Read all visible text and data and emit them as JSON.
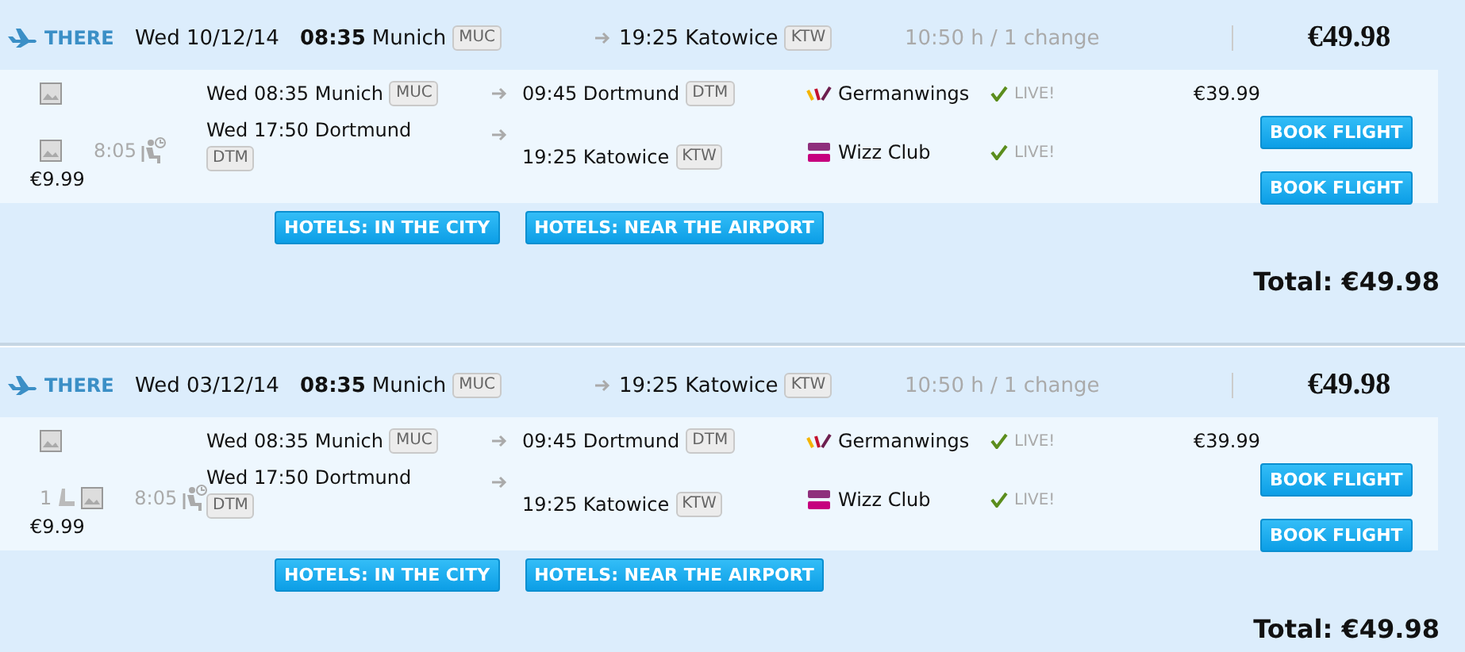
{
  "results": [
    {
      "direction": "THERE",
      "date": "Wed 10/12/14",
      "dep_time": "08:35",
      "dep_city": "Munich",
      "dep_code": "MUC",
      "arrival": "19:25 Katowice",
      "arr_code": "KTW",
      "duration": "10:50 h / 1 change",
      "price": "€49.98",
      "segments": [
        {
          "departure": "Wed 08:35 Munich",
          "from_code": "MUC",
          "arrival": "09:45 Dortmund",
          "to_code": "DTM",
          "airline": "Germanwings",
          "kind": "germanwings",
          "status": "LIVE!",
          "price": "€39.99"
        },
        {
          "departure": "Wed 17:50 Dortmund",
          "from_code": "DTM",
          "arrival": "19:25 Katowice",
          "to_code": "KTW",
          "airline": "Wizz Club",
          "kind": "wizz",
          "status": "LIVE!",
          "price": "€9.99",
          "layover": "8:05"
        }
      ],
      "book_buttons": [
        "BOOK FLIGHT",
        "BOOK FLIGHT"
      ],
      "hotel_buttons": [
        "HOTELS: IN THE CITY",
        "HOTELS: NEAR THE AIRPORT"
      ],
      "total": "Total: €49.98"
    },
    {
      "direction": "THERE",
      "date": "Wed 03/12/14",
      "dep_time": "08:35",
      "dep_city": "Munich",
      "dep_code": "MUC",
      "arrival": "19:25 Katowice",
      "arr_code": "KTW",
      "duration": "10:50 h / 1 change",
      "price": "€49.98",
      "segments": [
        {
          "departure": "Wed 08:35 Munich",
          "from_code": "MUC",
          "arrival": "09:45 Dortmund",
          "to_code": "DTM",
          "airline": "Germanwings",
          "kind": "germanwings",
          "status": "LIVE!",
          "price": "€39.99"
        },
        {
          "departure": "Wed 17:50 Dortmund",
          "from_code": "DTM",
          "arrival": "19:25 Katowice",
          "to_code": "KTW",
          "airline": "Wizz Club",
          "kind": "wizz",
          "status": "LIVE!",
          "price": "€9.99",
          "layover": "8:05",
          "seats": "1"
        }
      ],
      "book_buttons": [
        "BOOK FLIGHT",
        "BOOK FLIGHT"
      ],
      "hotel_buttons": [
        "HOTELS: IN THE CITY",
        "HOTELS: NEAR THE AIRPORT"
      ],
      "total": "Total: €49.98"
    }
  ]
}
